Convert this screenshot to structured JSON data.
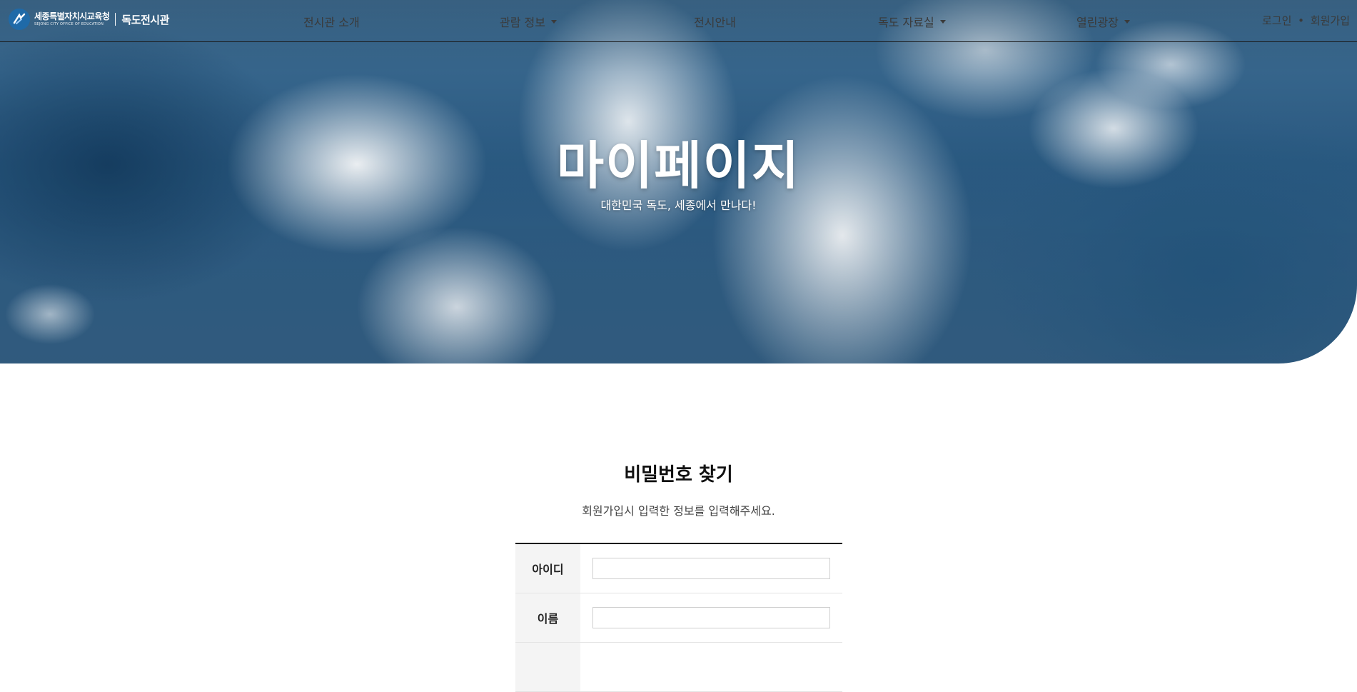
{
  "logo": {
    "office_ko": "세종특별자치시교육청",
    "office_en": "SEJONG CITY OFFICE OF EDUCATION",
    "museum": "독도전시관"
  },
  "nav": {
    "items": [
      {
        "label": "전시관 소개",
        "dropdown": false
      },
      {
        "label": "관람 정보",
        "dropdown": true
      },
      {
        "label": "전시안내",
        "dropdown": false
      },
      {
        "label": "독도 자료실",
        "dropdown": true
      },
      {
        "label": "열린광장",
        "dropdown": true
      }
    ],
    "login": "로그인",
    "separator": "•",
    "signup": "회원가입"
  },
  "hero": {
    "title": "마이페이지",
    "subtitle": "대한민국 독도, 세종에서 만나다!"
  },
  "find_password": {
    "title": "비밀번호 찾기",
    "description": "회원가입시 입력한 정보를 입력해주세요.",
    "fields": [
      {
        "label": "아이디",
        "value": "",
        "placeholder": ""
      },
      {
        "label": "이름",
        "value": "",
        "placeholder": ""
      },
      {
        "label": "",
        "value": "",
        "placeholder": ""
      }
    ]
  },
  "colors": {
    "sky_dark": "#2a5a82",
    "logo_mark": "#1f6aa8",
    "label_bg": "#f4f4f4"
  }
}
